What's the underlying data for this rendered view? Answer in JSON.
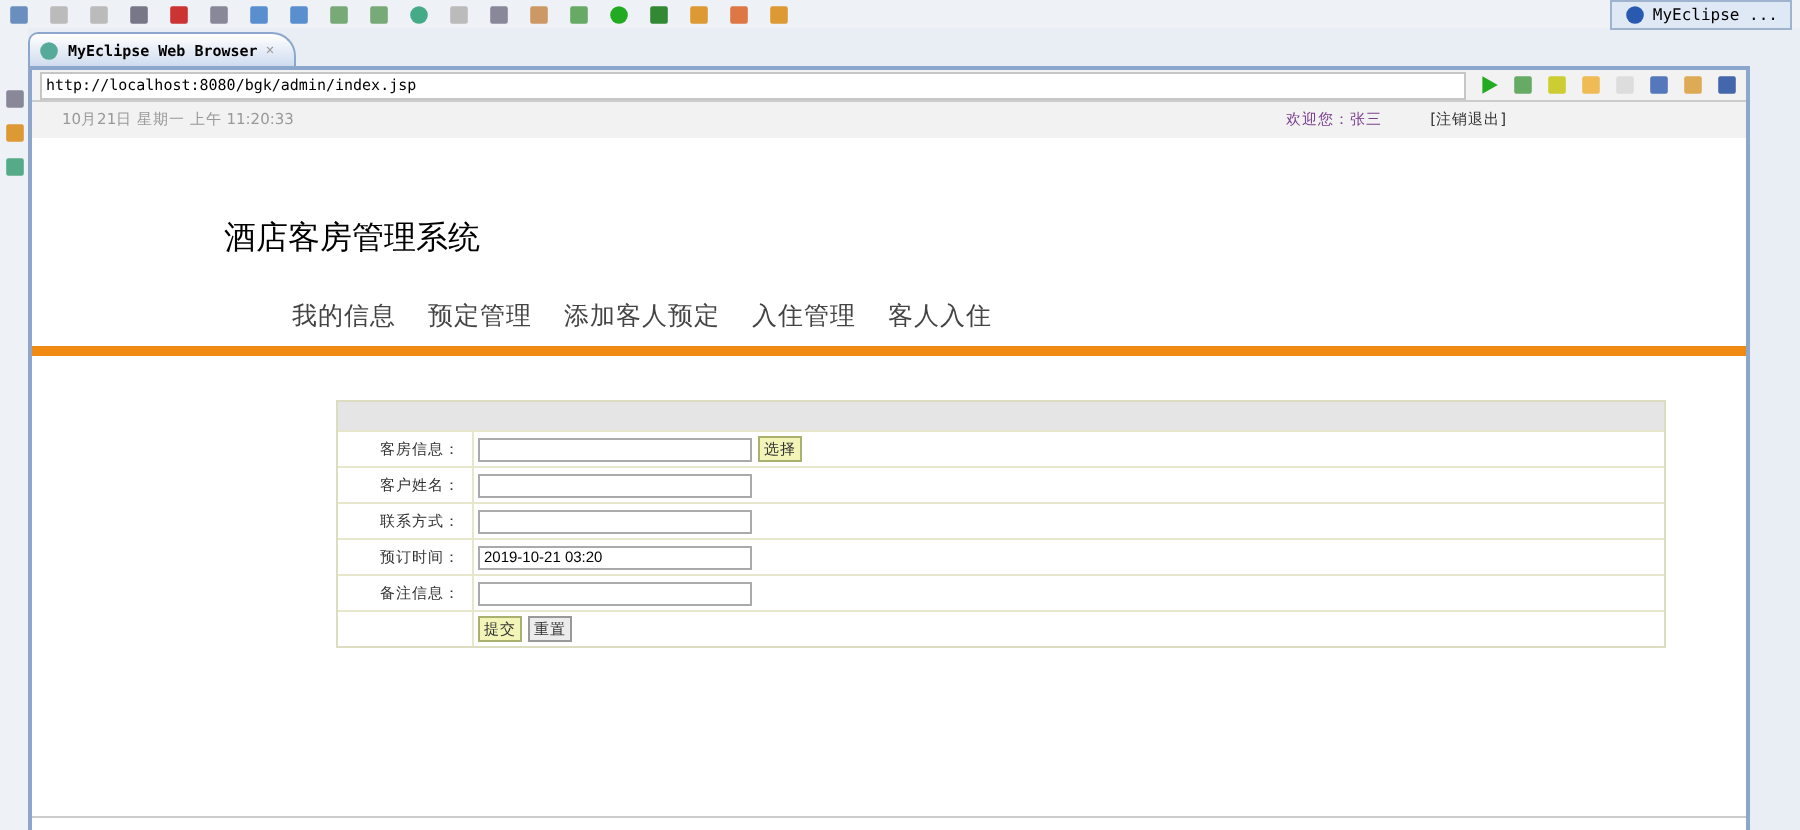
{
  "ide_tab": {
    "title": "MyEclipse Web Browser",
    "close": "✕"
  },
  "perspective": {
    "label": "MyEclipse ..."
  },
  "address_bar": {
    "url": "http://localhost:8080/bgk/admin/index.jsp"
  },
  "top_bar": {
    "datetime": "10月21日 星期一 上午 11:20:33",
    "welcome": "欢迎您：张三",
    "logout": "[注销退出]"
  },
  "site_title": "酒店客房管理系统",
  "nav": [
    {
      "label": "我的信息"
    },
    {
      "label": "预定管理"
    },
    {
      "label": "添加客人预定"
    },
    {
      "label": "入住管理"
    },
    {
      "label": "客人入住"
    }
  ],
  "form": {
    "fields": [
      {
        "label": "客房信息：",
        "button": "选择"
      },
      {
        "label": "客户姓名："
      },
      {
        "label": "联系方式："
      },
      {
        "label": "预订时间：",
        "value": "2019-10-21 03:20"
      },
      {
        "label": "备注信息："
      }
    ],
    "buttons": [
      {
        "label": "提交",
        "kind": "primary"
      },
      {
        "label": "重置",
        "kind": "secondary"
      }
    ]
  }
}
